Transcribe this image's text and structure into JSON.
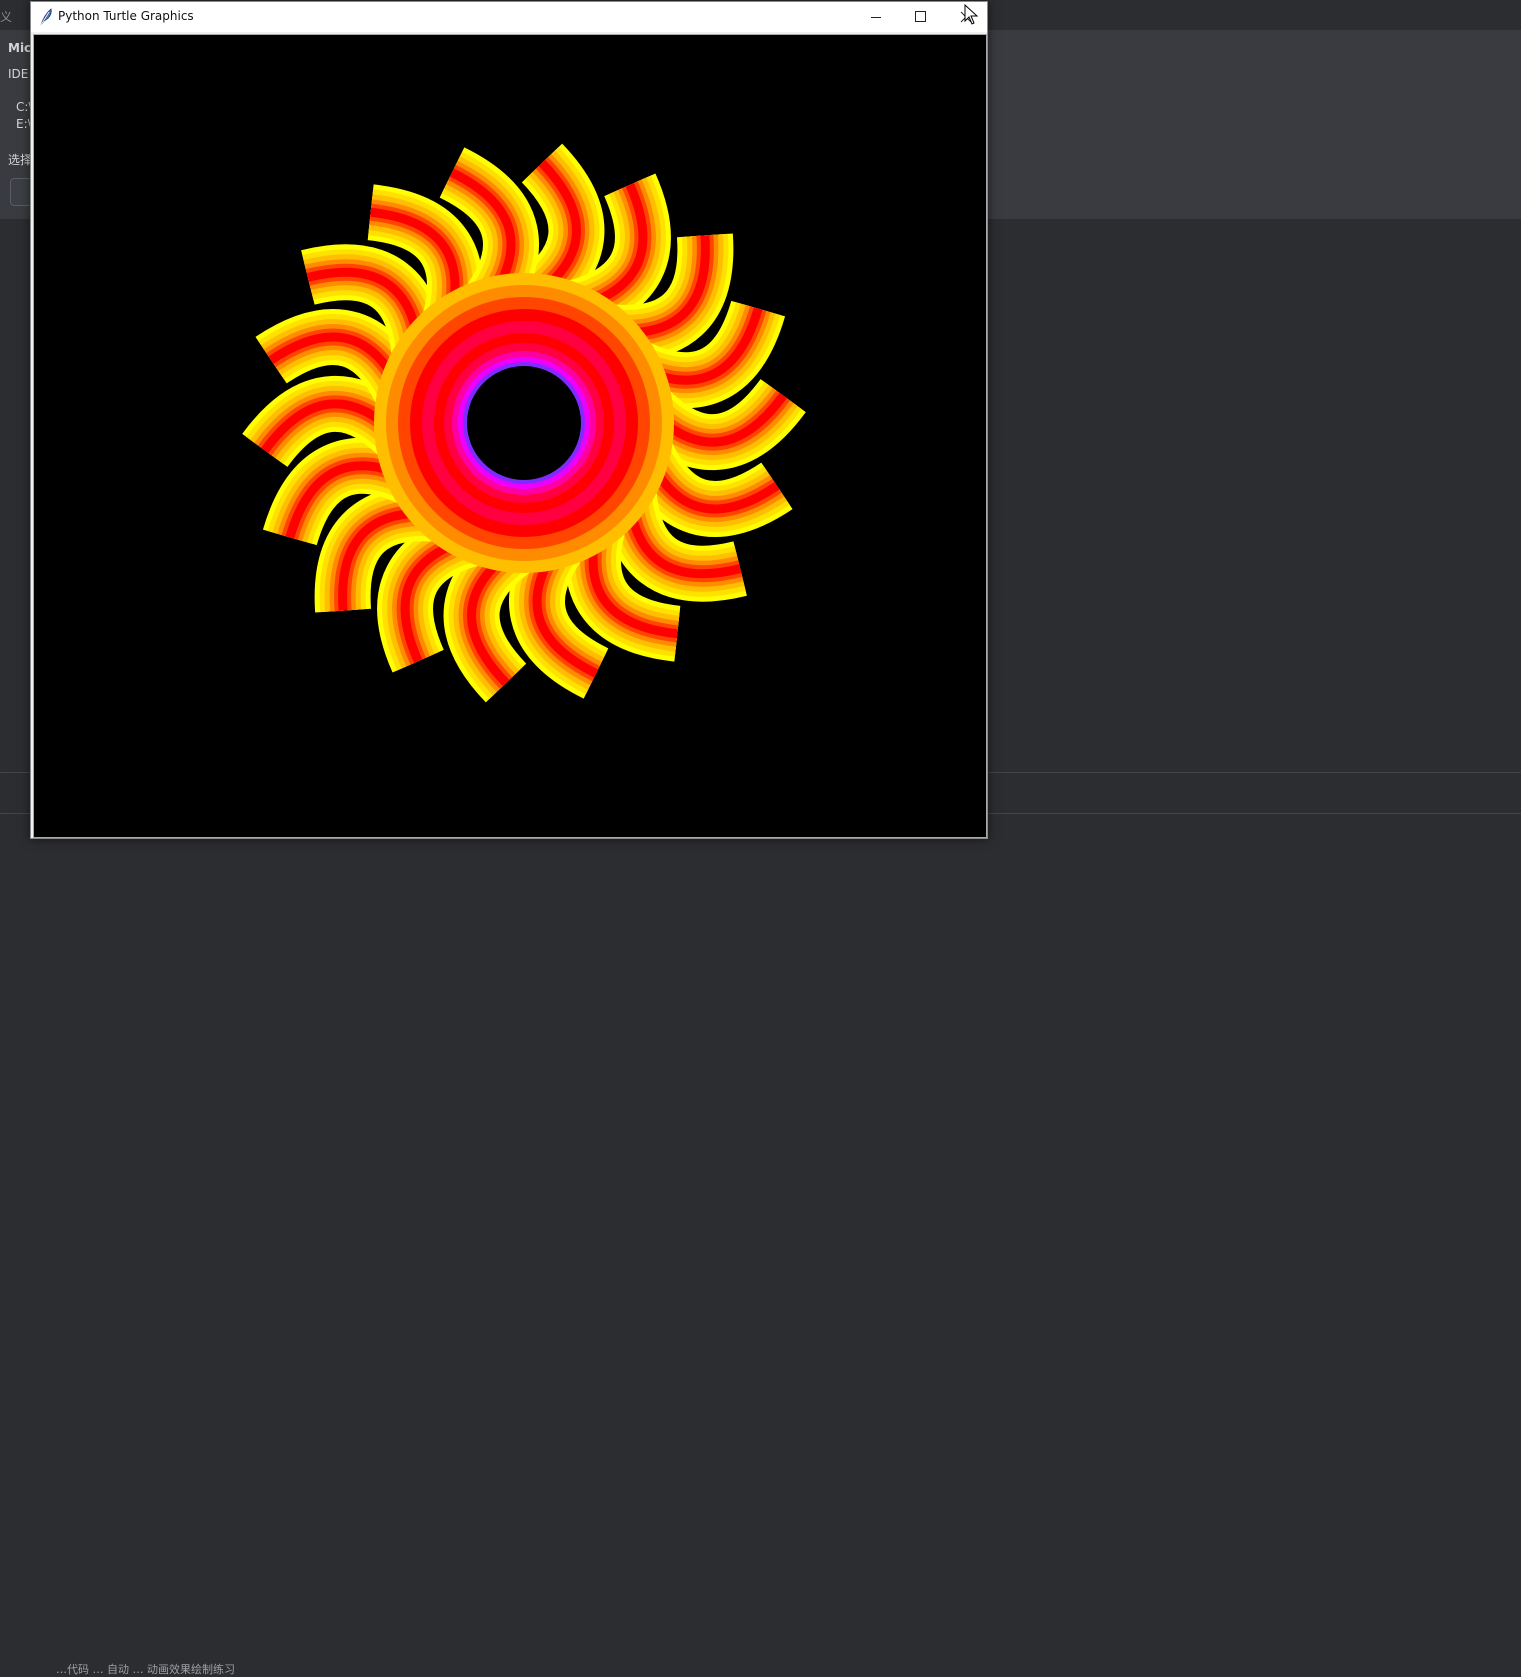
{
  "ide": {
    "topbar_glyph": "义",
    "notice": {
      "title": "Mic",
      "subtitle": "IDE",
      "path_1": "C:\\",
      "path_2": "E:\\",
      "choose": "选择"
    },
    "status_text": "…代码 … 自动 … 动画效果绘制练习"
  },
  "window": {
    "title": "Python Turtle Graphics",
    "app_icon": "feather-icon",
    "controls": {
      "minimize": "minimize-icon",
      "maximize": "maximize-icon",
      "close": "close-icon"
    }
  },
  "drawing": {
    "background": "#000000",
    "petals": 18,
    "palette": [
      "#ffff00",
      "#ffe100",
      "#ffbf00",
      "#ff8c00",
      "#ff4500",
      "#ff0000",
      "#ff0040",
      "#ff00a0",
      "#ee00ff",
      "#7f2bff"
    ],
    "center_color": "#000000"
  }
}
